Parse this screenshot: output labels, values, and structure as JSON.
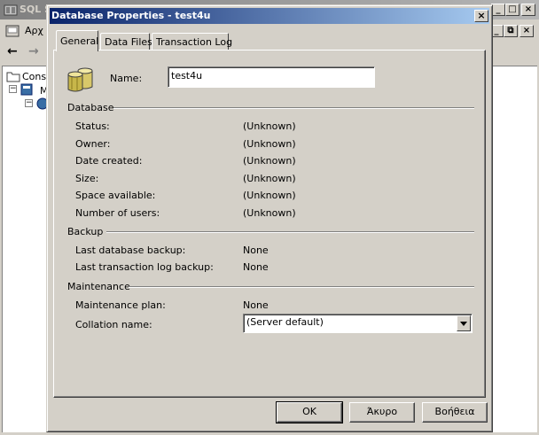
{
  "background_app": {
    "title": "SQL S",
    "menu_label": "Αρχ",
    "tree_root": "Cons",
    "tree_item": "M"
  },
  "dialog": {
    "title": "Database Properties - test4u",
    "tabs": [
      "General",
      "Data Files",
      "Transaction Log"
    ],
    "name_label": "Name:",
    "name_value": "test4u",
    "sections": {
      "database": {
        "heading": "Database",
        "rows": [
          {
            "label": "Status:",
            "value": "(Unknown)"
          },
          {
            "label": "Owner:",
            "value": "(Unknown)"
          },
          {
            "label": "Date created:",
            "value": "(Unknown)"
          },
          {
            "label": "Size:",
            "value": "(Unknown)"
          },
          {
            "label": "Space available:",
            "value": "(Unknown)"
          },
          {
            "label": "Number of users:",
            "value": "(Unknown)"
          }
        ]
      },
      "backup": {
        "heading": "Backup",
        "rows": [
          {
            "label": "Last database backup:",
            "value": "None"
          },
          {
            "label": "Last transaction log backup:",
            "value": "None"
          }
        ]
      },
      "maintenance": {
        "heading": "Maintenance",
        "plan_label": "Maintenance plan:",
        "plan_value": "None",
        "collation_label": "Collation name:",
        "collation_value": "(Server default)"
      }
    },
    "buttons": {
      "ok": "OK",
      "cancel": "Άκυρο",
      "help": "Βοήθεια"
    }
  }
}
